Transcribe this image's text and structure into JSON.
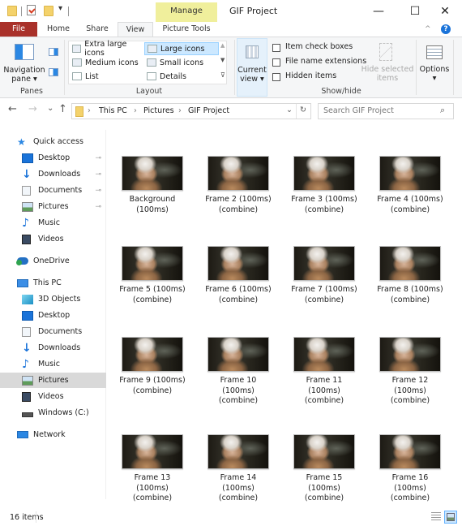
{
  "window": {
    "title": "GIF Project",
    "context_tab_group": "Manage",
    "controls": {
      "minimize": "—",
      "maximize": "☐",
      "close": "✕"
    }
  },
  "ribbon": {
    "tabs": [
      {
        "label": "File",
        "state": "file"
      },
      {
        "label": "Home"
      },
      {
        "label": "Share"
      },
      {
        "label": "View",
        "state": "active"
      },
      {
        "label": "Picture Tools"
      }
    ],
    "panes": {
      "navigation_pane": "Navigation\npane ▾",
      "group_label": "Panes"
    },
    "layout": {
      "items": [
        {
          "label": "Extra large icons"
        },
        {
          "label": "Large icons",
          "selected": true
        },
        {
          "label": "Medium icons"
        },
        {
          "label": "Small icons"
        },
        {
          "label": "List"
        },
        {
          "label": "Details"
        }
      ],
      "group_label": "Layout"
    },
    "current_view": {
      "label": "Current\nview ▾"
    },
    "show_hide": {
      "checkboxes": [
        {
          "label": "Item check boxes",
          "checked": false
        },
        {
          "label": "File name extensions",
          "checked": false
        },
        {
          "label": "Hidden items",
          "checked": false
        }
      ],
      "hide_selected": "Hide selected\nitems",
      "group_label": "Show/hide"
    },
    "options": {
      "label": "Options\n▾"
    }
  },
  "navigation": {
    "back": "←",
    "forward": "→",
    "recent": "⌄",
    "up": "↑",
    "breadcrumb": [
      "This PC",
      "Pictures",
      "GIF Project"
    ],
    "separator": "›",
    "refresh": "↻",
    "dropdown": "⌄",
    "search_placeholder": "Search GIF Project",
    "search_icon": "⌕"
  },
  "sidebar": {
    "quick_access": {
      "label": "Quick access",
      "items": [
        {
          "label": "Desktop",
          "icon": "desktop-icon",
          "pinned": true
        },
        {
          "label": "Downloads",
          "icon": "downloads-icon",
          "pinned": true
        },
        {
          "label": "Documents",
          "icon": "documents-icon",
          "pinned": true
        },
        {
          "label": "Pictures",
          "icon": "pictures-icon",
          "pinned": true
        },
        {
          "label": "Music",
          "icon": "music-icon",
          "pinned": false
        },
        {
          "label": "Videos",
          "icon": "videos-icon",
          "pinned": false
        }
      ]
    },
    "onedrive": {
      "label": "OneDrive"
    },
    "this_pc": {
      "label": "This PC",
      "items": [
        {
          "label": "3D Objects",
          "icon": "3d-objects-icon"
        },
        {
          "label": "Desktop",
          "icon": "desktop-icon"
        },
        {
          "label": "Documents",
          "icon": "documents-icon"
        },
        {
          "label": "Downloads",
          "icon": "downloads-icon"
        },
        {
          "label": "Music",
          "icon": "music-icon"
        },
        {
          "label": "Pictures",
          "icon": "pictures-icon",
          "selected": true
        },
        {
          "label": "Videos",
          "icon": "videos-icon"
        },
        {
          "label": "Windows (C:)",
          "icon": "drive-icon"
        }
      ]
    },
    "network": {
      "label": "Network"
    },
    "pin_glyph": "📌"
  },
  "files": [
    {
      "label": "Background\n(100ms)"
    },
    {
      "label": "Frame 2 (100ms)\n(combine)"
    },
    {
      "label": "Frame 3 (100ms)\n(combine)"
    },
    {
      "label": "Frame 4 (100ms)\n(combine)"
    },
    {
      "label": "Frame 5 (100ms)\n(combine)"
    },
    {
      "label": "Frame 6 (100ms)\n(combine)"
    },
    {
      "label": "Frame 7 (100ms)\n(combine)"
    },
    {
      "label": "Frame 8 (100ms)\n(combine)"
    },
    {
      "label": "Frame 9 (100ms)\n(combine)"
    },
    {
      "label": "Frame 10\n(100ms)\n(combine)"
    },
    {
      "label": "Frame 11\n(100ms)\n(combine)"
    },
    {
      "label": "Frame 12\n(100ms)\n(combine)"
    },
    {
      "label": "Frame 13\n(100ms)\n(combine)"
    },
    {
      "label": "Frame 14\n(100ms)\n(combine)"
    },
    {
      "label": "Frame 15\n(100ms)\n(combine)"
    },
    {
      "label": "Frame 16\n(100ms)\n(combine)"
    }
  ],
  "status": {
    "item_count": "16 items",
    "view_details": "details-view",
    "view_large": "large-icons-view"
  },
  "colors": {
    "file_tab": "#a9312a",
    "manage_tab": "#f0ef9c",
    "selection": "#cce8ff",
    "sidebar_selected": "#d9d9d9",
    "accent_blue": "#1a73d9"
  }
}
